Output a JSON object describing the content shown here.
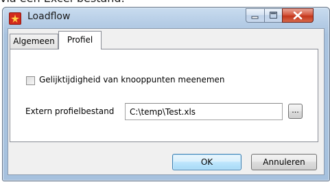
{
  "background": {
    "text": "via een Excel-bestand."
  },
  "window": {
    "title": "Loadflow",
    "icon": "loadflow-app-icon",
    "accent": "#a6c1de"
  },
  "window_controls": [
    "minimize",
    "maximize",
    "close"
  ],
  "tabs": [
    {
      "label": "Algemeen",
      "selected": false
    },
    {
      "label": "Profiel",
      "selected": true
    }
  ],
  "profiel": {
    "checkbox_label": "Gelijktijdigheid van knooppunten meenemen",
    "checkbox_checked": false,
    "file_label": "Extern profielbestand",
    "file_value": "C:\\temp\\Test.xls",
    "browse_label": "..."
  },
  "buttons": {
    "ok": "OK",
    "cancel": "Annuleren"
  }
}
